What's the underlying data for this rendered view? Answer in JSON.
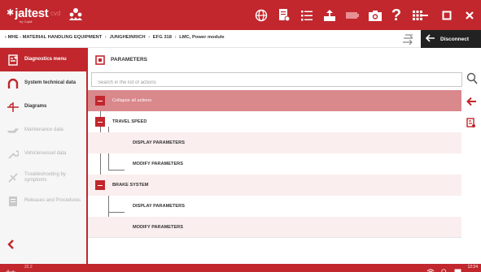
{
  "app": {
    "logo_name": "jaltest",
    "logo_sub": "by Cojali",
    "logo_badge": "cvd"
  },
  "window_controls": {
    "minimize": "–",
    "maximize": "□",
    "close": "✕"
  },
  "breadcrumb": {
    "items": [
      "MHE - MATERIAL HANDLING EQUIPMENT",
      "JUNGHEINRICH",
      "EFG 318",
      "LMC, Power module"
    ],
    "separator": "›"
  },
  "disconnect": {
    "label": "Disconnect"
  },
  "sidebar": {
    "items": [
      {
        "label": "Diagnostics menu",
        "icon": "diagnostics-menu-icon",
        "state": "active"
      },
      {
        "label": "System technical data",
        "icon": "magnet-icon",
        "state": "normal"
      },
      {
        "label": "Diagrams",
        "icon": "diagram-icon",
        "state": "normal"
      },
      {
        "label": "Maintenance data",
        "icon": "oil-can-icon",
        "state": "disabled"
      },
      {
        "label": "Vehicle/vessel data",
        "icon": "wrench-icon",
        "state": "disabled"
      },
      {
        "label": "Troubleshooting by symptoms",
        "icon": "troubleshooting-icon",
        "state": "disabled"
      },
      {
        "label": "Releases and Procedures",
        "icon": "procedures-icon",
        "state": "disabled"
      }
    ]
  },
  "main": {
    "title": "PARAMETERS",
    "search_placeholder": "Search in the list of actions"
  },
  "tree": {
    "collapse_all": "Collapse all actions",
    "groups": [
      {
        "label": "TRAVEL SPEED",
        "children": [
          "DISPLAY PARAMETERS",
          "MODIFY PARAMETERS"
        ]
      },
      {
        "label": "BRAKE SYSTEM",
        "children": [
          "DISPLAY PARAMETERS",
          "MODIFY PARAMETERS"
        ]
      }
    ]
  },
  "status": {
    "version": "22.2",
    "clock": "12:24"
  },
  "colors": {
    "brand_red": "#c1272d",
    "collapse_row": "#d9888c",
    "alt_row": "#fbeeee",
    "disconnect_bg": "#222222"
  }
}
